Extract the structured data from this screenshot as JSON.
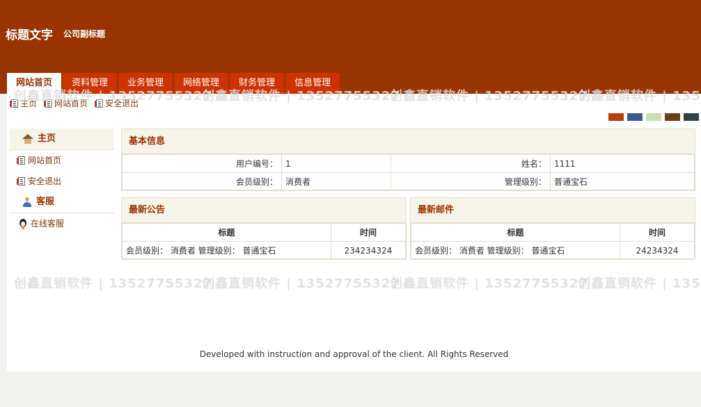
{
  "header": {
    "title": "标题文字",
    "subtitle": "公司副标题"
  },
  "nav": {
    "tabs": [
      {
        "label": "网站首页",
        "active": true
      },
      {
        "label": "资料管理"
      },
      {
        "label": "业务管理"
      },
      {
        "label": "网络管理"
      },
      {
        "label": "财务管理"
      },
      {
        "label": "信息管理"
      }
    ]
  },
  "breadcrumb": {
    "items": [
      "主页",
      "网站首页",
      "安全退出"
    ]
  },
  "theme_colors": [
    "#b83c0c",
    "#3b5a94",
    "#c9dfb2",
    "#6b3f1c",
    "#2f4246"
  ],
  "sidebar": {
    "home_head": "主页",
    "home_items": [
      "网站首页",
      "安全退出"
    ],
    "service_head": "客服",
    "service_items": [
      "在线客服"
    ]
  },
  "basic_info": {
    "title": "基本信息",
    "user_id_label": "用户编号：",
    "user_id": "1",
    "name_label": "姓名：",
    "name": "1111",
    "member_level_label": "会员级别：",
    "member_level": "消费者",
    "admin_level_label": "管理级别：",
    "admin_level": "普通宝石"
  },
  "notices": {
    "title": "最新公告",
    "col_title": "标题",
    "col_time": "时间",
    "rows": [
      {
        "title": "会员级别： 消费者 管理级别： 普通宝石",
        "time": "234234324"
      }
    ]
  },
  "mails": {
    "title": "最新邮件",
    "col_title": "标题",
    "col_time": "时间",
    "rows": [
      {
        "title": "会员级别： 消费者 管理级别： 普通宝石",
        "time": "24234324"
      }
    ]
  },
  "footer": {
    "text": "Developed with instruction and approval of the client. All Rights Reserved"
  },
  "watermark": {
    "text": "创鑫直销软件 | 13527755327"
  }
}
